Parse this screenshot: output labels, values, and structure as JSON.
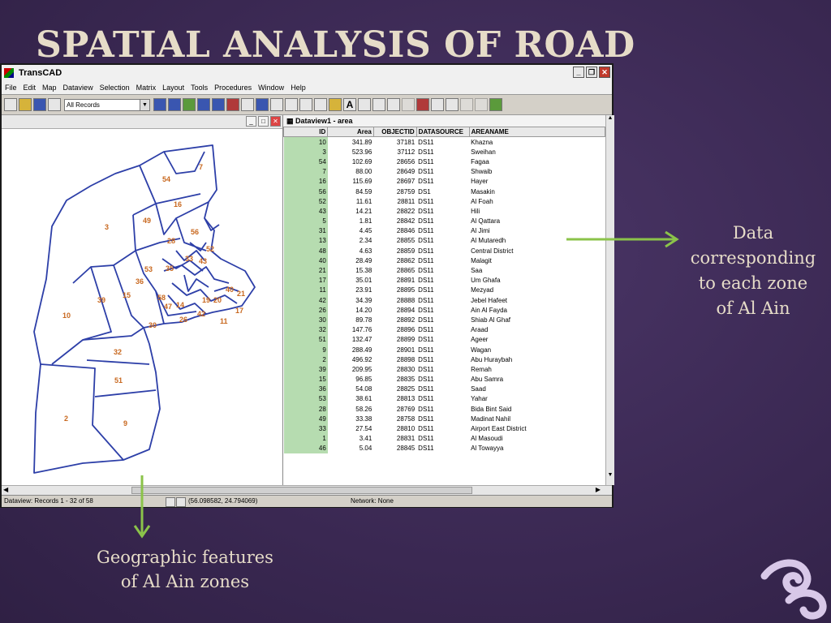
{
  "slide": {
    "title": "SPATIAL ANALYSIS OF ROAD",
    "annotation_right": [
      "Data",
      "corresponding",
      "to each zone",
      "of Al Ain"
    ],
    "annotation_bottom": [
      "Geographic features",
      "of Al Ain zones"
    ],
    "arrow_color": "#8bc34a"
  },
  "window": {
    "title": "TransCAD",
    "menu": [
      "File",
      "Edit",
      "Map",
      "Dataview",
      "Selection",
      "Matrix",
      "Layout",
      "Tools",
      "Procedures",
      "Window",
      "Help"
    ],
    "toolbar_combo": "All Records"
  },
  "dataview": {
    "title": "Dataview1 - area",
    "columns": [
      "ID",
      "Area",
      "OBJECTID",
      "DATASOURCE",
      "AREANAME"
    ],
    "rows": [
      [
        "10",
        "341.89",
        "37181",
        "DS11",
        "Khazna"
      ],
      [
        "3",
        "523.96",
        "37112",
        "DS11",
        "Sweihan"
      ],
      [
        "54",
        "102.69",
        "28656",
        "DS11",
        "Fagaa"
      ],
      [
        "7",
        "88.00",
        "28649",
        "DS11",
        "Shwaib"
      ],
      [
        "16",
        "115.69",
        "28697",
        "DS11",
        "Hayer"
      ],
      [
        "56",
        "84.59",
        "28759",
        "DS1",
        "Masakin"
      ],
      [
        "52",
        "11.61",
        "28811",
        "DS11",
        "Al Foah"
      ],
      [
        "43",
        "14.21",
        "28822",
        "DS11",
        "Hili"
      ],
      [
        "5",
        "1.81",
        "28842",
        "DS11",
        "Al Qattara"
      ],
      [
        "31",
        "4.45",
        "28846",
        "DS11",
        "Al Jimi"
      ],
      [
        "13",
        "2.34",
        "28855",
        "DS11",
        "Al Mutaredh"
      ],
      [
        "48",
        "4.63",
        "28859",
        "DS11",
        "Central District"
      ],
      [
        "40",
        "28.49",
        "28862",
        "DS11",
        "Malagit"
      ],
      [
        "21",
        "15.38",
        "28865",
        "DS11",
        "Saa"
      ],
      [
        "17",
        "35.01",
        "28891",
        "DS11",
        "Um Ghafa"
      ],
      [
        "11",
        "23.91",
        "28895",
        "DS11",
        "Mezyad"
      ],
      [
        "42",
        "34.39",
        "28888",
        "DS11",
        "Jebel Hafeet"
      ],
      [
        "26",
        "14.20",
        "28894",
        "DS11",
        "Ain Al Fayda"
      ],
      [
        "30",
        "89.78",
        "28892",
        "DS11",
        "Shiab Al Ghaf"
      ],
      [
        "32",
        "147.76",
        "28896",
        "DS11",
        "Araad"
      ],
      [
        "51",
        "132.47",
        "28899",
        "DS11",
        "Ageer"
      ],
      [
        "9",
        "288.49",
        "28901",
        "DS11",
        "Wagan"
      ],
      [
        "2",
        "496.92",
        "28898",
        "DS11",
        "Abu Huraybah"
      ],
      [
        "39",
        "209.95",
        "28830",
        "DS11",
        "Remah"
      ],
      [
        "15",
        "96.85",
        "28835",
        "DS11",
        "Abu Samra"
      ],
      [
        "36",
        "54.08",
        "28825",
        "DS11",
        "Saad"
      ],
      [
        "53",
        "38.61",
        "28813",
        "DS11",
        "Yahar"
      ],
      [
        "28",
        "58.26",
        "28769",
        "DS11",
        "Bida Bint Said"
      ],
      [
        "49",
        "33.38",
        "28758",
        "DS11",
        "Madinat Nahil"
      ],
      [
        "33",
        "27.54",
        "28810",
        "DS11",
        "Airport East District"
      ],
      [
        "1",
        "3.41",
        "28831",
        "DS11",
        "Al Masoudi"
      ],
      [
        "46",
        "5.04",
        "28845",
        "DS11",
        "Al Towayya"
      ]
    ]
  },
  "map": {
    "zone_labels": [
      "7",
      "54",
      "16",
      "49",
      "3",
      "56",
      "28",
      "52",
      "53",
      "35",
      "33",
      "43",
      "36",
      "15",
      "39",
      "10",
      "58",
      "47",
      "14",
      "40",
      "17",
      "11",
      "42",
      "30",
      "32",
      "51",
      "2",
      "9",
      "26",
      "19",
      "20",
      "21"
    ]
  },
  "status": {
    "records": "Dataview: Records 1 - 32 of 58",
    "coords": "(56.098582, 24.794069)",
    "network": "Network: None"
  }
}
